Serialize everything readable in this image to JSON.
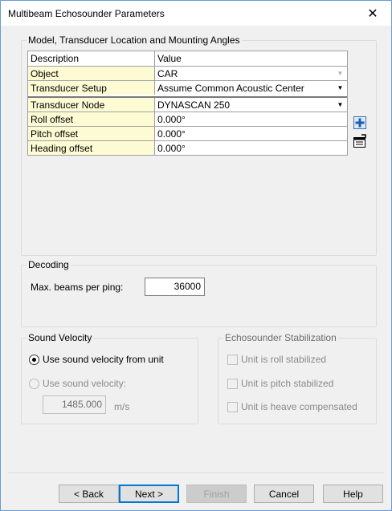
{
  "window": {
    "title": "Multibeam Echosounder Parameters",
    "close_glyph": "✕"
  },
  "model_group": {
    "legend": "Model, Transducer Location and Mounting Angles",
    "header": {
      "description": "Description",
      "value": "Value"
    },
    "rows": [
      {
        "description": "Object",
        "value": "CAR"
      },
      {
        "description": "Transducer Setup",
        "value": "Assume Common Acoustic Center"
      },
      {
        "description": "Transducer Node",
        "value": "DYNASCAN 250"
      },
      {
        "description": "Roll offset",
        "value": "0.000°"
      },
      {
        "description": "Pitch offset",
        "value": "0.000°"
      },
      {
        "description": "Heading offset",
        "value": "0.000°"
      }
    ],
    "icons": [
      "add-icon",
      "properties-icon"
    ]
  },
  "decoding_group": {
    "legend": "Decoding",
    "max_beams_label": "Max.  beams per ping:",
    "max_beams_value": "36000"
  },
  "sound_velocity_group": {
    "legend": "Sound Velocity",
    "option_unit": "Use sound velocity from unit",
    "option_manual": "Use sound velocity:",
    "velocity_value": "1485.000",
    "velocity_unit": "m/s",
    "selected": "unit"
  },
  "stabilization_group": {
    "legend": "Echosounder Stabilization",
    "roll": "Unit is roll stabilized",
    "pitch": "Unit is pitch stabilized",
    "heave": "Unit is heave compensated"
  },
  "buttons": {
    "back": "< Back",
    "next": "Next >",
    "finish": "Finish",
    "cancel": "Cancel",
    "help": "Help"
  }
}
